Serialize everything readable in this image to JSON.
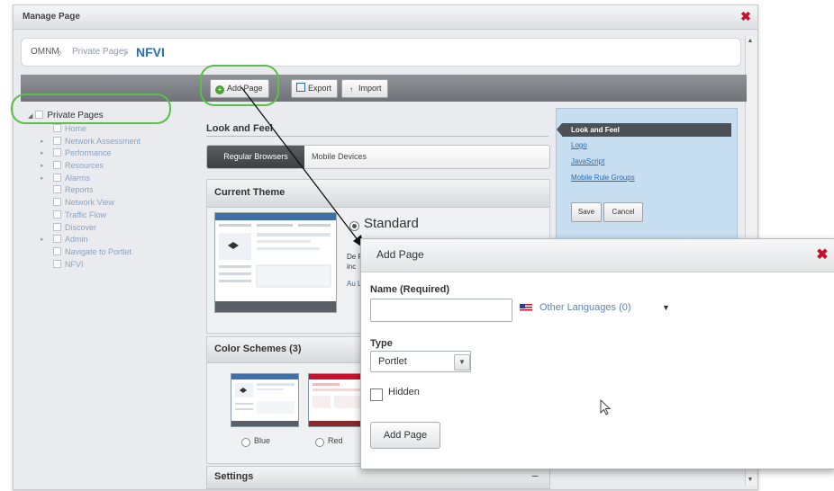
{
  "manage_dialog": {
    "title": "Manage Page",
    "close_glyph": "✖"
  },
  "breadcrumb": {
    "items": [
      "OMNM",
      "Private Pages",
      "NFVI"
    ]
  },
  "toolbar": {
    "add_page": "Add Page",
    "export": "Export",
    "import": "Import",
    "import_icon_glyph": "↑"
  },
  "tree": {
    "root": "Private Pages",
    "items": [
      {
        "label": "Home",
        "expandable": false
      },
      {
        "label": "Network Assessment",
        "expandable": true
      },
      {
        "label": "Performance",
        "expandable": true
      },
      {
        "label": "Resources",
        "expandable": true
      },
      {
        "label": "Alarms",
        "expandable": true
      },
      {
        "label": "Reports",
        "expandable": false
      },
      {
        "label": "Network View",
        "expandable": false
      },
      {
        "label": "Traffic Flow",
        "expandable": false
      },
      {
        "label": "Discover",
        "expandable": false
      },
      {
        "label": "Admin",
        "expandable": true
      },
      {
        "label": "Navigate to Portlet",
        "expandable": false
      },
      {
        "label": "NFVI",
        "expandable": false
      }
    ]
  },
  "look_and_feel": {
    "title": "Look and Feel",
    "tabs": {
      "regular": "Regular Browsers",
      "mobile": "Mobile Devices"
    },
    "current_theme": {
      "title": "Current Theme",
      "selected_theme": "Standard",
      "description_fragment": "De Po inc",
      "author_fragment": "Au Lif"
    },
    "color_schemes": {
      "title": "Color Schemes (3)",
      "options": [
        "Blue",
        "Red"
      ]
    },
    "settings": {
      "title": "Settings",
      "toggle": "−"
    }
  },
  "side_panel": {
    "active": "Look and Feel",
    "links": [
      "Logo",
      "JavaScript",
      "Mobile Rule Groups"
    ],
    "save": "Save",
    "cancel": "Cancel"
  },
  "add_page_dialog": {
    "title": "Add Page",
    "close_glyph": "✖",
    "name_label": "Name (Required)",
    "name_value": "",
    "other_languages": "Other Languages (0)",
    "other_languages_caret": "▼",
    "type_label": "Type",
    "type_value": "Portlet",
    "hidden_label": "Hidden",
    "hidden_checked": false,
    "submit": "Add Page"
  },
  "colors": {
    "highlight": "#5cbf48",
    "close": "#c8102e",
    "link": "#2a6bb3",
    "side_panel_bg": "#c6def0"
  },
  "icons": [
    "close-icon",
    "add-icon",
    "export-icon",
    "import-icon",
    "flag-icon",
    "mouse-cursor-icon",
    "scroll-up-icon",
    "scroll-down-icon"
  ]
}
